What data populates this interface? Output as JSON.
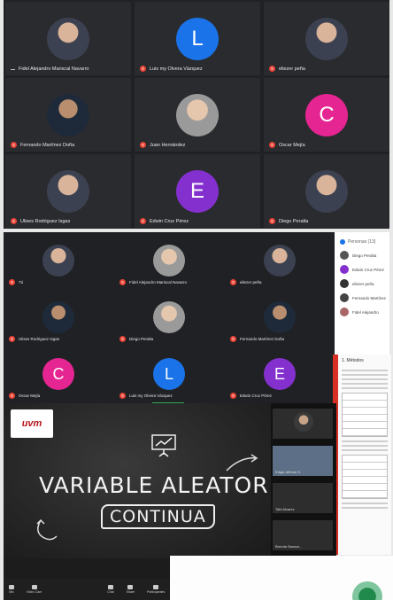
{
  "panel1": {
    "tiles": [
      {
        "name": "Fidel Alejandro Mariscal Navarro",
        "initial": "",
        "color": "",
        "muted": false
      },
      {
        "name": "Luis my Olvera Vázquez",
        "initial": "L",
        "color": "#1a73e8",
        "muted": true
      },
      {
        "name": "eliezer peña",
        "initial": "",
        "color": "",
        "muted": true
      },
      {
        "name": "Fernando Martínez Doña",
        "initial": "",
        "color": "",
        "muted": true
      },
      {
        "name": "Juan Hernández",
        "initial": "",
        "color": "",
        "muted": true
      },
      {
        "name": "Oscar Mejía",
        "initial": "C",
        "color": "#e52592",
        "muted": true
      },
      {
        "name": "Ulises Rodriguez Isgas",
        "initial": "",
        "color": "",
        "muted": true
      },
      {
        "name": "Edwin Cruz Pérez",
        "initial": "E",
        "color": "#8430ce",
        "muted": true
      },
      {
        "name": "Diego Peralta",
        "initial": "",
        "color": "",
        "muted": true
      }
    ]
  },
  "panel2": {
    "tiles": [
      {
        "name": "Tú",
        "initial": "",
        "color": ""
      },
      {
        "name": "Fidel Alejandro Mariscal Navarro",
        "initial": "",
        "color": ""
      },
      {
        "name": "eliezer peña",
        "initial": "",
        "color": ""
      },
      {
        "name": "Ulises Rodriguez Isgas",
        "initial": "",
        "color": ""
      },
      {
        "name": "Diego Peralta",
        "initial": "",
        "color": ""
      },
      {
        "name": "Fernando Martínez Doña",
        "initial": "",
        "color": ""
      },
      {
        "name": "Oscar Mejía",
        "initial": "C",
        "color": "#e52592"
      },
      {
        "name": "Luis my Olvera Vázquez",
        "initial": "L",
        "color": "#1a73e8"
      },
      {
        "name": "Edwin Cruz Pérez",
        "initial": "E",
        "color": "#8430ce"
      }
    ],
    "people_title": "Personas (13)",
    "people": [
      {
        "name": "Diego Peralta",
        "color": "#555"
      },
      {
        "name": "Edwin Cruz Pérez",
        "color": "#8430ce"
      },
      {
        "name": "eliezer peña",
        "color": "#333"
      },
      {
        "name": "Fernando Martínez",
        "color": "#444"
      },
      {
        "name": "Fidel Alejandro",
        "color": "#a66"
      }
    ],
    "doc_title": "1. Métodos"
  },
  "panel3": {
    "logo_text": "uvm",
    "slide_title": "VARIABLE ALEATOR",
    "slide_subtitle": "CONTINUA",
    "side_labels": [
      "Edgar Alfredo S.",
      "Tabi Alvarez",
      "Brenda Sarava..."
    ],
    "toolbar": [
      "Mic",
      "Video Cam",
      "Chat",
      "Share",
      "Participantes"
    ]
  }
}
